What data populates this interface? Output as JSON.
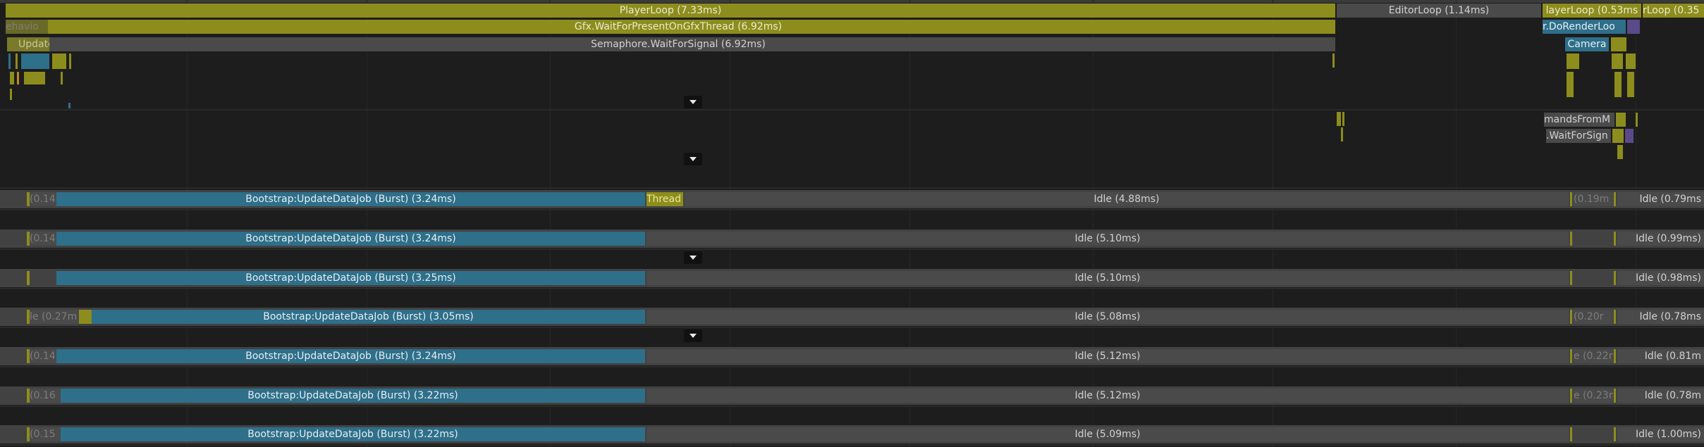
{
  "main_thread": {
    "player_loop": "PlayerLoop (7.33ms)",
    "gfx_wait": "Gfx.WaitForPresentOnGfxThread (6.92ms)",
    "semaphore": "Semaphore.WaitForSignal (6.92ms)",
    "behaviour": "ehavio",
    "update": "Update",
    "editor_loop": "EditorLoop (1.14ms)",
    "player_loop_2": "layerLoop (0.53ms",
    "player_loop_3": "rLoop (0.35",
    "do_render_loop": "r.DoRenderLoo",
    "camera": "Camera"
  },
  "render_thread": {
    "commands_from": "mandsFromM",
    "wait_for_signal": ".WaitForSign"
  },
  "job_lanes": [
    {
      "pre": "(0.14",
      "job": "Bootstrap:UpdateDataJob (Burst) (3.24ms)",
      "post": "Thread",
      "idle": "Idle (4.88ms)",
      "small": "(0.19m",
      "idle_right": "Idle (0.79ms"
    },
    {
      "pre": "(0.14",
      "job": "Bootstrap:UpdateDataJob (Burst) (3.24ms)",
      "post": "",
      "idle": "Idle (5.10ms)",
      "small": "",
      "idle_right": "Idle (0.99ms)"
    },
    {
      "pre": "",
      "job": "Bootstrap:UpdateDataJob (Burst) (3.25ms)",
      "post": "",
      "idle": "Idle (5.10ms)",
      "small": "",
      "idle_right": "Idle (0.98ms)"
    },
    {
      "pre": "le (0.27m",
      "job": "Bootstrap:UpdateDataJob (Burst) (3.05ms)",
      "post": "",
      "idle": "Idle (5.08ms)",
      "small": "(0.20r",
      "idle_right": "Idle (0.78ms"
    },
    {
      "pre": "(0.14",
      "job": "Bootstrap:UpdateDataJob (Burst) (3.24ms)",
      "post": "",
      "idle": "Idle (5.12ms)",
      "small": "e (0.22n",
      "idle_right": "Idle (0.81m"
    },
    {
      "pre": "(0.16",
      "job": "Bootstrap:UpdateDataJob (Burst) (3.22ms)",
      "post": "",
      "idle": "Idle (5.12ms)",
      "small": "e (0.23m",
      "idle_right": "Idle (0.78m"
    },
    {
      "pre": "(0.15",
      "job": "Bootstrap:UpdateDataJob (Burst) (3.22ms)",
      "post": "",
      "idle": "Idle (5.09ms)",
      "small": "",
      "idle_right": "Idle (1.00ms)"
    }
  ],
  "colors": {
    "olive": "#8d8d1d",
    "teal": "#2e6f8a",
    "grey": "#4a4a4a",
    "purple": "#5b4a8a",
    "background": "#1d1d1d"
  },
  "icons": [
    "expand-arrow-icon"
  ]
}
